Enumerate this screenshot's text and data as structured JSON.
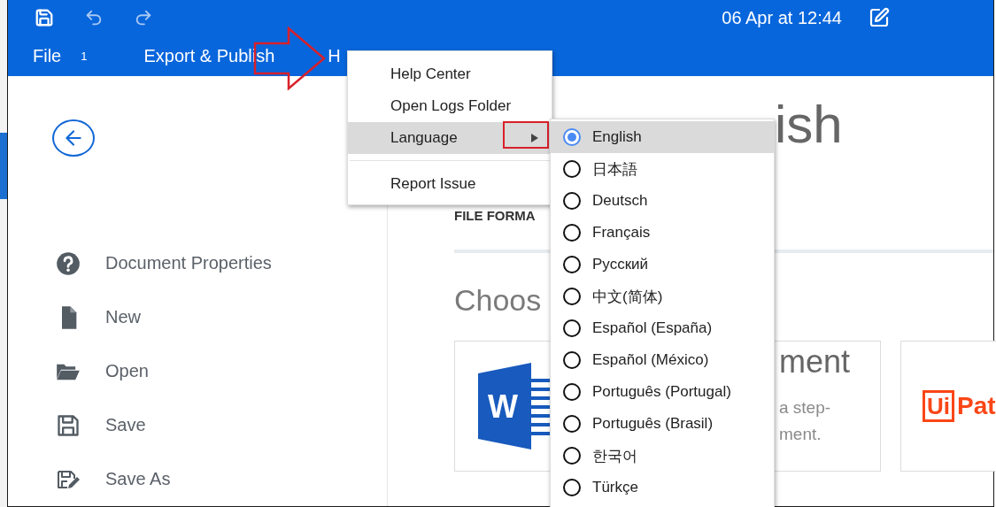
{
  "toolbar": {
    "date": "06 Apr at 12:44"
  },
  "menu_bar": [
    {
      "kind": "menu",
      "label": "File"
    },
    {
      "kind": "count",
      "label": "1"
    },
    {
      "kind": "menu",
      "label": "Export & Publish"
    },
    {
      "kind": "menu",
      "label": "H"
    }
  ],
  "sidebar": {
    "items": [
      {
        "kind": "properties",
        "label": "Document Properties"
      },
      {
        "kind": "new",
        "label": "New"
      },
      {
        "kind": "open",
        "label": "Open"
      },
      {
        "kind": "save",
        "label": "Save"
      },
      {
        "kind": "save_as",
        "label": "Save As"
      }
    ]
  },
  "content": {
    "title": "ish",
    "section_label": "FILE FORMA",
    "heading": "Choos",
    "cards": [
      {
        "kind": "word",
        "letter": "W",
        "title": "ment",
        "description": [
          "a step-",
          "ment."
        ]
      },
      {
        "kind": "uipath",
        "logo_box": "Ui",
        "logo_text": "Pat"
      }
    ]
  },
  "help_menu": {
    "items": [
      {
        "kind": "item",
        "label": "Help Center",
        "highlighted": false
      },
      {
        "kind": "item",
        "label": "Open Logs Folder",
        "highlighted": false
      },
      {
        "kind": "submenu",
        "label": "Language",
        "highlighted": true
      },
      {
        "kind": "separator"
      },
      {
        "kind": "item",
        "label": "Report Issue",
        "highlighted": false
      }
    ]
  },
  "language_menu": {
    "items": [
      {
        "label": "English",
        "selected": true
      },
      {
        "label": "日本語",
        "selected": false
      },
      {
        "label": "Deutsch",
        "selected": false
      },
      {
        "label": "Français",
        "selected": false
      },
      {
        "label": "Русский",
        "selected": false
      },
      {
        "label": "中文(简体)",
        "selected": false
      },
      {
        "label": "Español (España)",
        "selected": false
      },
      {
        "label": "Español (México)",
        "selected": false
      },
      {
        "label": "Português (Portugal)",
        "selected": false
      },
      {
        "label": "Português (Brasil)",
        "selected": false
      },
      {
        "label": "한국어",
        "selected": false
      },
      {
        "label": "Türkçe",
        "selected": false
      }
    ]
  }
}
